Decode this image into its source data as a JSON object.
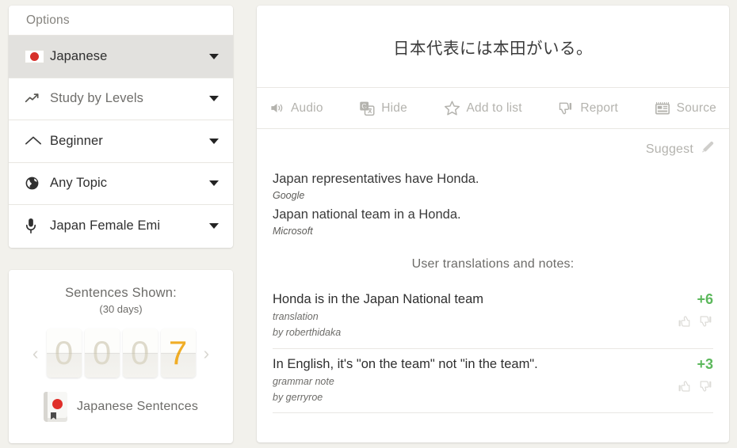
{
  "sidebar": {
    "header": "Options",
    "items": [
      {
        "label": "Japanese",
        "icon": "japan-flag-icon",
        "selected": true,
        "caret": true
      },
      {
        "label": "Study by Levels",
        "icon": "trending-up-icon",
        "selected": false,
        "caret": true
      },
      {
        "label": "Beginner",
        "icon": "chevron-up-icon",
        "selected": false,
        "caret": true
      },
      {
        "label": "Any Topic",
        "icon": "globe-icon",
        "selected": false,
        "caret": true
      },
      {
        "label": "Japan Female Emi",
        "icon": "microphone-icon",
        "selected": false,
        "caret": true
      }
    ]
  },
  "counter": {
    "title": "Sentences Shown:",
    "subtitle": "(30 days)",
    "digits": [
      "0",
      "0",
      "0",
      "7"
    ],
    "active_index": 3,
    "prev_arrow": "‹",
    "next_arrow": "›",
    "footer_label": "Japanese Sentences",
    "active_color": "#f0ad26",
    "inactive_color": "#dedacb"
  },
  "main": {
    "sentence": "日本代表には本田がいる。",
    "toolbar": [
      {
        "label": "Audio",
        "icon": "speaker-icon"
      },
      {
        "label": "Hide",
        "icon": "translate-icon"
      },
      {
        "label": "Add to list",
        "icon": "star-icon"
      },
      {
        "label": "Report",
        "icon": "thumbs-down-icon"
      },
      {
        "label": "Source",
        "icon": "newspaper-icon"
      }
    ],
    "suggest": {
      "label": "Suggest",
      "icon": "pencil-icon"
    },
    "machine_translations": [
      {
        "text": "Japan representatives have Honda.",
        "source": "Google"
      },
      {
        "text": "Japan national team in a Honda.",
        "source": "Microsoft"
      }
    ],
    "user_section_heading": "User translations and notes:",
    "user_translations": [
      {
        "text": "Honda is in the Japan National team",
        "kind": "translation",
        "author": "by roberthidaka",
        "score": "+6",
        "score_color": "#5cb85c"
      },
      {
        "text": "In English, it's \"on the team\" not \"in the team\".",
        "kind": "grammar note",
        "author": "by gerryroe",
        "score": "+3",
        "score_color": "#5cb85c"
      }
    ]
  }
}
